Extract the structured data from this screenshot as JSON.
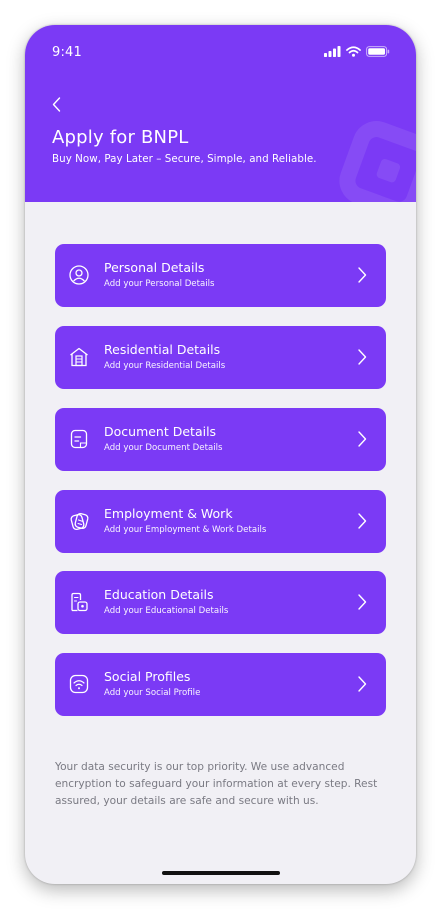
{
  "status_bar": {
    "time": "9:41"
  },
  "header": {
    "title": "Apply for BNPL",
    "subtitle": "Buy Now, Pay Later – Secure, Simple, and Reliable.",
    "background": "#7B3AF5"
  },
  "sections": [
    {
      "title": "Personal Details",
      "subtitle": "Add your Personal Details",
      "icon": "user-circle-icon"
    },
    {
      "title": "Residential Details",
      "subtitle": "Add your Residential Details",
      "icon": "home-icon"
    },
    {
      "title": "Document Details",
      "subtitle": "Add your Document Details",
      "icon": "document-icon"
    },
    {
      "title": "Employment & Work",
      "subtitle": "Add your Employment & Work Details",
      "icon": "briefcase-icon"
    },
    {
      "title": "Education Details",
      "subtitle": "Add your Educational Details",
      "icon": "education-icon"
    },
    {
      "title": "Social Profiles",
      "subtitle": "Add your Social Profile",
      "icon": "wifi-icon"
    }
  ],
  "footer": {
    "security_note": "Your data security is our top priority. We use advanced encryption to safeguard your information at every step. Rest assured, your details are safe and secure with us."
  },
  "colors": {
    "accent": "#7B3AF5",
    "background": "#F1F0F5",
    "note_text": "#7A7A83"
  }
}
